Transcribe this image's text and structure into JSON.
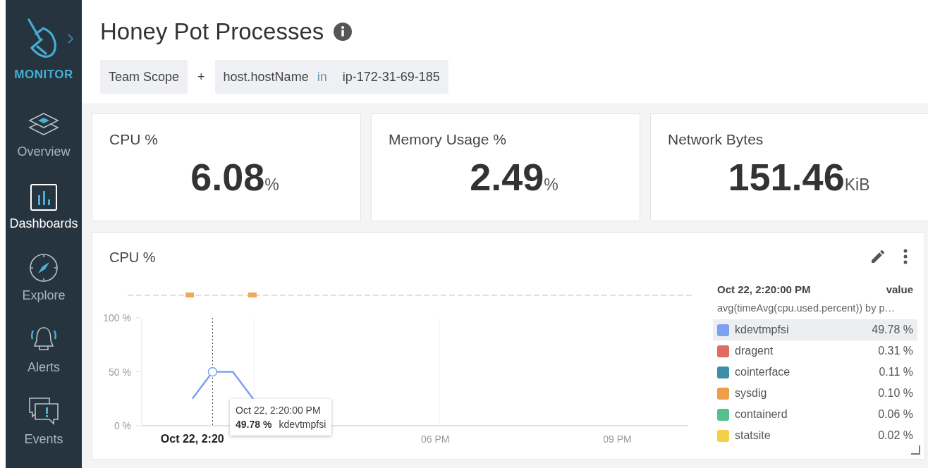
{
  "sidebar": {
    "brand": "MONITOR",
    "items": [
      {
        "label": "Overview",
        "selected": false
      },
      {
        "label": "Dashboards",
        "selected": true
      },
      {
        "label": "Explore",
        "selected": false
      },
      {
        "label": "Alerts",
        "selected": false
      },
      {
        "label": "Events",
        "selected": false
      }
    ]
  },
  "header": {
    "title": "Honey Pot Processes",
    "scope": [
      {
        "kind": "chip",
        "label": "Team Scope"
      },
      {
        "kind": "plus",
        "label": "+"
      },
      {
        "kind": "filter",
        "key": "host.hostName",
        "op": "in",
        "value": "ip-172-31-69-185"
      }
    ]
  },
  "stats": [
    {
      "title": "CPU %",
      "value": "6.08",
      "unit": "%"
    },
    {
      "title": "Memory Usage %",
      "value": "2.49",
      "unit": "%"
    },
    {
      "title": "Network Bytes",
      "value": "151.46",
      "unit": "KiB"
    }
  ],
  "panel": {
    "title": "CPU %",
    "chart_data": {
      "type": "line",
      "categories": [
        null,
        null,
        "Oct 22, 2:20",
        null,
        null,
        null,
        null,
        null,
        null,
        null,
        null,
        null,
        null,
        null,
        "06 PM",
        null,
        null,
        null,
        null,
        null,
        null,
        null,
        null,
        "09 PM",
        null,
        null,
        null
      ],
      "series": [
        {
          "name": "kdevtmpfsi",
          "color": "#7ba1f0",
          "values": [
            null,
            null,
            25,
            50,
            50,
            25,
            null,
            null,
            null,
            null,
            null,
            null,
            null,
            null,
            null,
            null,
            null,
            null,
            null,
            null,
            null,
            null,
            null,
            null,
            null,
            null,
            null
          ]
        }
      ],
      "ylim": [
        0,
        100
      ],
      "yticks": [
        {
          "value": 0,
          "label": "0 %"
        },
        {
          "value": 50,
          "label": "50 %"
        },
        {
          "value": 100,
          "label": "100 %"
        }
      ]
    },
    "tooltip": {
      "time": "Oct 22, 2:20:00 PM",
      "value": "49.78 %"
    },
    "legend": {
      "time": "Oct 22, 2:20:00 PM",
      "column": "value",
      "query": "avg(timeAvg(cpu.used.percent)) by p…",
      "items": [
        {
          "name": "kdevtmpfsi",
          "value": "49.78 %",
          "color": "#7ba1f0",
          "selected": true
        },
        {
          "name": "dragent",
          "value": "0.31 %",
          "color": "#e06b64",
          "selected": false
        },
        {
          "name": "cointerface",
          "value": "0.11 %",
          "color": "#3d8ea8",
          "selected": false
        },
        {
          "name": "sysdig",
          "value": "0.10 %",
          "color": "#ee9d4a",
          "selected": false
        },
        {
          "name": "containerd",
          "value": "0.06 %",
          "color": "#55c08f",
          "selected": false
        },
        {
          "name": "statsite",
          "value": "0.02 %",
          "color": "#f5cf47",
          "selected": false
        }
      ]
    }
  }
}
